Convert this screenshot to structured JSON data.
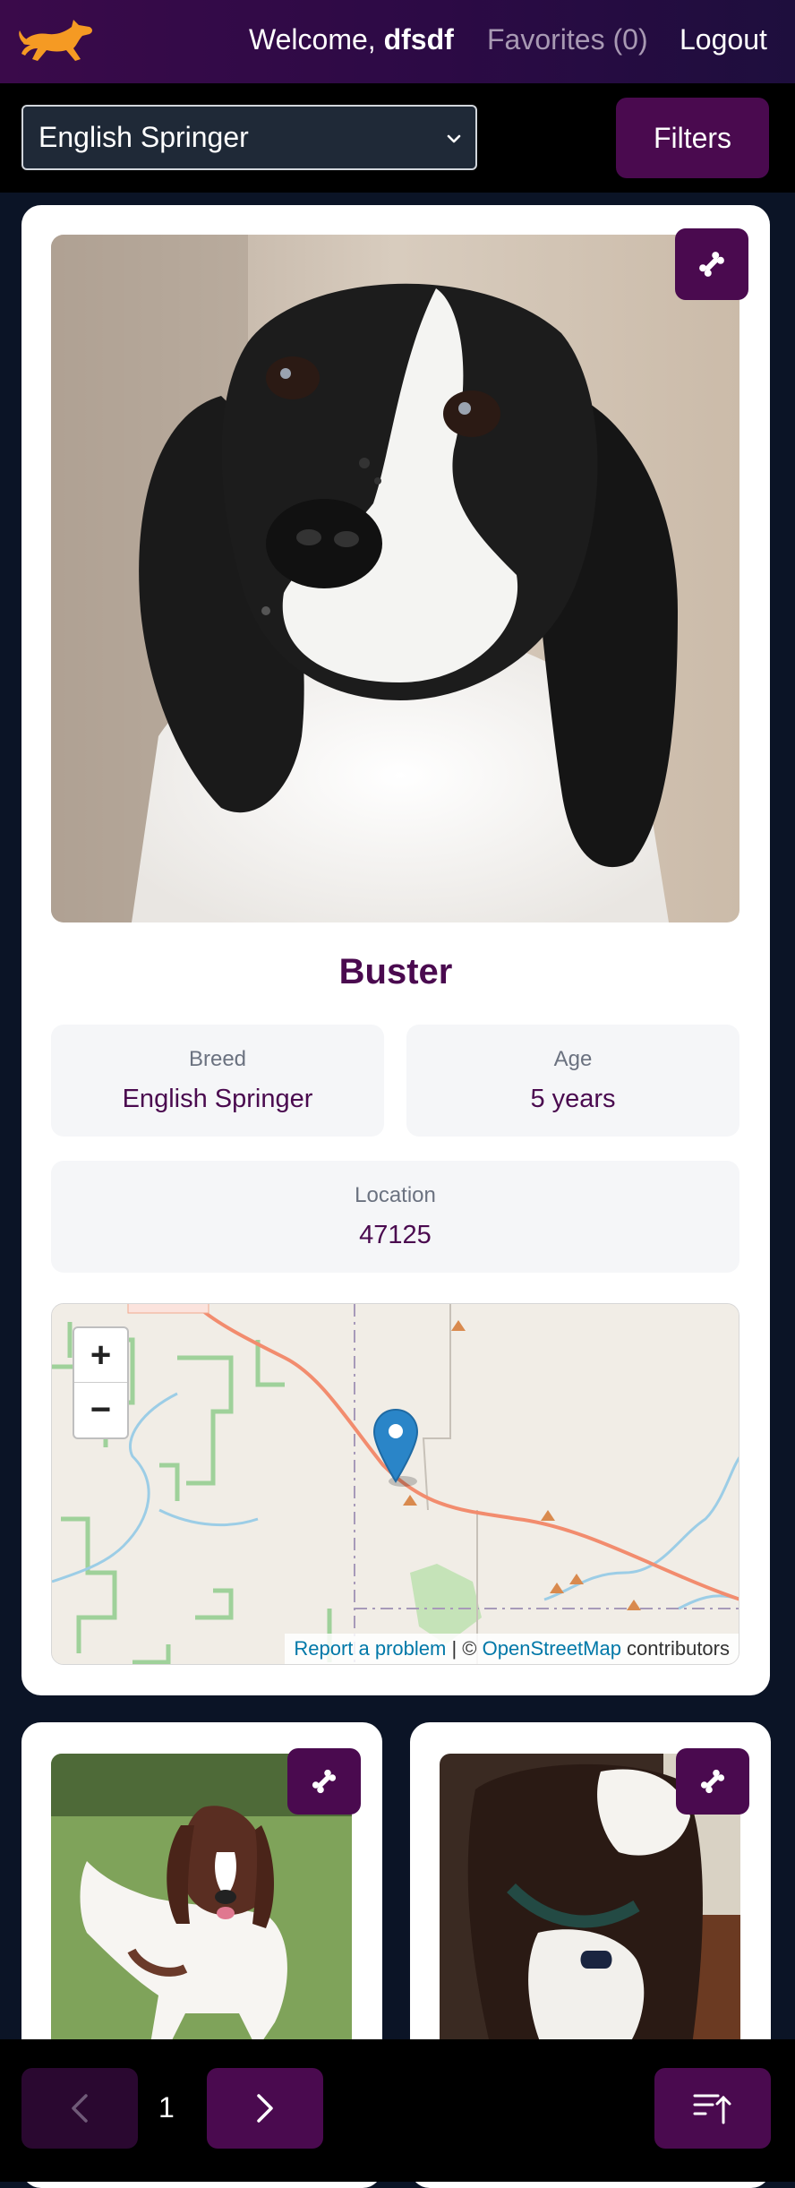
{
  "header": {
    "welcome_prefix": "Welcome, ",
    "username": "dfsdf",
    "favorites_label": "Favorites (0)",
    "logout_label": "Logout",
    "logo_icon": "running-dog-logo"
  },
  "toolbar": {
    "breed_selected": "English Springer",
    "filters_label": "Filters"
  },
  "main_card": {
    "name": "Buster",
    "breed_label": "Breed",
    "breed_value": "English Springer",
    "age_label": "Age",
    "age_value": "5 years",
    "location_label": "Location",
    "location_value": "47125",
    "fetch_icon": "bone-icon"
  },
  "map": {
    "zoom_in": "+",
    "zoom_out": "−",
    "report_problem": "Report a problem",
    "separator": " | © ",
    "osm_link": "OpenStreetMap",
    "contributors": " contributors"
  },
  "pagination": {
    "page": "1",
    "prev_icon": "chevron-left-icon",
    "next_icon": "chevron-right-icon",
    "sort_icon": "sort-ascending-icon"
  },
  "colors": {
    "brand": "#4a0a4f",
    "accent_orange": "#f59a23",
    "background": "#0b1426"
  }
}
